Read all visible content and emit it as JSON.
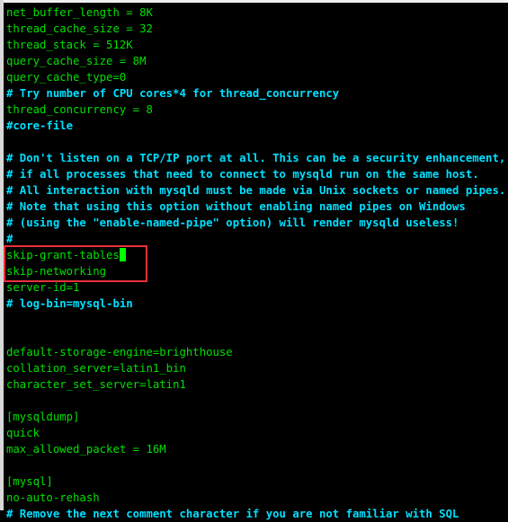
{
  "terminal": {
    "lines": [
      {
        "text": "net_buffer_length = 8K",
        "type": "setting"
      },
      {
        "text": "thread_cache_size = 32",
        "type": "setting"
      },
      {
        "text": "thread_stack = 512K",
        "type": "setting"
      },
      {
        "text": "query_cache_size = 8M",
        "type": "setting"
      },
      {
        "text": "query_cache_type=0",
        "type": "setting"
      },
      {
        "text": "# Try number of CPU cores*4 for thread_concurrency",
        "type": "comment"
      },
      {
        "text": "thread_concurrency = 8",
        "type": "setting"
      },
      {
        "text": "#core-file",
        "type": "comment"
      },
      {
        "text": "",
        "type": "setting"
      },
      {
        "text": "# Don't listen on a TCP/IP port at all. This can be a security enhancement,",
        "type": "comment"
      },
      {
        "text": "# if all processes that need to connect to mysqld run on the same host.",
        "type": "comment"
      },
      {
        "text": "# All interaction with mysqld must be made via Unix sockets or named pipes.",
        "type": "comment"
      },
      {
        "text": "# Note that using this option without enabling named pipes on Windows",
        "type": "comment"
      },
      {
        "text": "# (using the \"enable-named-pipe\" option) will render mysqld useless!",
        "type": "comment"
      },
      {
        "text": "#",
        "type": "comment"
      },
      {
        "text": "skip-grant-tables",
        "type": "setting",
        "cursor": true
      },
      {
        "text": "skip-networking",
        "type": "setting"
      },
      {
        "text": "server-id=1",
        "type": "setting"
      },
      {
        "text": "# log-bin=mysql-bin",
        "type": "comment"
      },
      {
        "text": "",
        "type": "setting"
      },
      {
        "text": "",
        "type": "setting"
      },
      {
        "text": "default-storage-engine=brighthouse",
        "type": "setting"
      },
      {
        "text": "collation_server=latin1_bin",
        "type": "setting"
      },
      {
        "text": "character_set_server=latin1",
        "type": "setting"
      },
      {
        "text": "",
        "type": "setting"
      },
      {
        "text": "[mysqldump]",
        "type": "setting"
      },
      {
        "text": "quick",
        "type": "setting"
      },
      {
        "text": "max_allowed_packet = 16M",
        "type": "setting"
      },
      {
        "text": "",
        "type": "setting"
      },
      {
        "text": "[mysql]",
        "type": "setting"
      },
      {
        "text": "no-auto-rehash",
        "type": "setting"
      },
      {
        "text": "# Remove the next comment character if you are not familiar with SQL",
        "type": "comment"
      }
    ]
  },
  "colors": {
    "setting": "#00e000",
    "comment": "#00e0ff",
    "highlight_box": "#e8303a",
    "cursor": "#00ff00"
  }
}
